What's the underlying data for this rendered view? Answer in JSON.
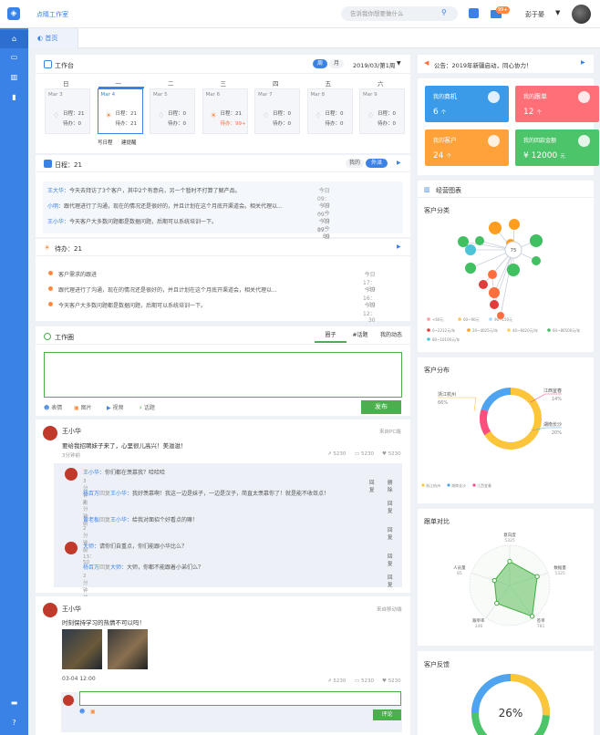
{
  "app": {
    "name": "点睛工作室"
  },
  "header": {
    "search_placeholder": "告诉我你想要做什么",
    "mail_badge": "99+",
    "username": "彭于晏"
  },
  "tabs": [
    {
      "label": "首页"
    }
  ],
  "workbench": {
    "title": "工作台",
    "toggle": [
      "周",
      "月"
    ],
    "active_toggle": "周",
    "period": "2019/03/第1周",
    "weekdays": [
      "日",
      "一",
      "二",
      "三",
      "四",
      "五",
      "六"
    ],
    "days": [
      {
        "date": "Mar 3",
        "schedule": "日程：21",
        "todo": "待办：0",
        "todo_alert": false,
        "lit": false
      },
      {
        "date": "Mar 4",
        "schedule": "日程：21",
        "todo": "待办：21",
        "todo_alert": false,
        "lit": true,
        "selected": true
      },
      {
        "date": "Mar 5",
        "schedule": "日程：0",
        "todo": "待办：0",
        "todo_alert": false,
        "lit": false
      },
      {
        "date": "Mar 6",
        "schedule": "日程：21",
        "todo": "待办：99+",
        "todo_alert": true,
        "lit": true
      },
      {
        "date": "Mar 7",
        "schedule": "日程：0",
        "todo": "待办：0",
        "todo_alert": false,
        "lit": false
      },
      {
        "date": "Mar 8",
        "schedule": "日程：0",
        "todo": "待办：0",
        "todo_alert": false,
        "lit": false
      },
      {
        "date": "Mar 9",
        "schedule": "日程：0",
        "todo": "待办：0",
        "todo_alert": false,
        "lit": false
      }
    ],
    "day_actions": [
      "写日程",
      "建提醒"
    ]
  },
  "schedule": {
    "title": "日程：21",
    "toggle": [
      "我的",
      "外派"
    ],
    "items": [
      {
        "name": "王大华：",
        "text": "今天去拜访了3个客户，其中2个有意向，另一个暂时不打算了解产品。",
        "time": "今日 09：00 ~ 今日 17：30"
      },
      {
        "name": "小明：",
        "text": "跟代理进行了沟通，现在的情况还是很好的，并且计划在这个月底开渠道会。相关代理以...",
        "time": "今日 09：00 ~ 今日 17：30"
      },
      {
        "name": "王小华：",
        "text": "今天客户大多数问题都是数据问题，后期可以系统培训一下。",
        "time": "今日 09：00 ~ 今日 17：30"
      }
    ]
  },
  "todo": {
    "title": "待办：21",
    "items": [
      {
        "text": "客户需求的跟进",
        "time": "今日 17：30"
      },
      {
        "text": "跟代理进行了沟通，现在的情况还是很好的，并且计划在这个月底开渠道会，相关代理以...",
        "time": "今日 16：30"
      },
      {
        "text": "今天客户大多数问题都是数据问题，后期可以系统培训一下。",
        "time": "今日 12：30"
      }
    ]
  },
  "circle": {
    "title": "工作圈",
    "tabs": [
      "圈子",
      "#话题",
      "我的动态"
    ],
    "tools": [
      "表情",
      "图片",
      "视频",
      "话题"
    ],
    "publish": "发布"
  },
  "posts": [
    {
      "author": "王小华",
      "source": "来自PC端",
      "content": "要给我招聘妹子来了，心里很儿高兴！美滋滋！",
      "time": "3分钟前",
      "stats": [
        "5230",
        "5230",
        "5230"
      ],
      "replies": [
        {
          "from": "王小华：",
          "text": "你们都在羡慕我？哈哈哈",
          "time": "3分钟前",
          "actions": [
            "回复",
            "删除"
          ]
        },
        {
          "from": "杨百万",
          "mid": "回复",
          "to": "王小华：",
          "text": "我好羡慕啊！我这一边是妹子，一边是汉子，简直太羡慕你了！就是能不收敛点！",
          "time": "2分钟前",
          "action": "回复"
        },
        {
          "from": "黄老板",
          "mid": "回复",
          "to": "王小华：",
          "text": "给我对面招个好看点的嘛！",
          "time": "2分钟前",
          "action": "回复"
        },
        {
          "from": "大师：",
          "text": "请你们自重点，你们能跟小华比么？",
          "time": "13：50",
          "action": "回复"
        },
        {
          "from": "杨百万",
          "mid": "回复",
          "to": "大师：",
          "text": "大师，你都不能跟着小弟们么？",
          "time": "2分钟前",
          "action": "回复"
        }
      ]
    },
    {
      "author": "王小华",
      "source": "来自移动端",
      "content": "时刻保持学习的热情不可以吗！",
      "time": "03-04 12:00",
      "stats": [
        "5230",
        "5230",
        "5230"
      ],
      "comment_button": "评论"
    }
  ],
  "notice": {
    "text": "公告：2019年新疆启动，同心协力！"
  },
  "stats": [
    {
      "label": "我的",
      "label2": "商机",
      "value": "6",
      "unit": "个",
      "color": "#3b9be8"
    },
    {
      "label": "我的",
      "label2": "跟单",
      "value": "12",
      "unit": "个",
      "color": "#ff6f77"
    },
    {
      "label": "我的",
      "label2": "客户",
      "value": "24",
      "unit": "个",
      "color": "#ffa23a"
    },
    {
      "label": "我的回款金额",
      "label2": "",
      "value": "¥ 12000",
      "unit": "元",
      "color": "#4cc46a"
    }
  ],
  "charts_title": "经营图表",
  "chart_data": [
    {
      "type": "network",
      "title": "客户分类",
      "center_value": "75",
      "legend": [
        "<60元",
        "60~90元",
        "90~150元",
        "0~2212元/年",
        "20~4025元/年",
        "40~6020元/年",
        "60~80500元/年",
        "80~10100元/年"
      ]
    },
    {
      "type": "pie",
      "title": "客户分布",
      "slices": [
        {
          "name": "浙江杭州",
          "value": 66,
          "label": "66%",
          "color": "#fcc53a"
        },
        {
          "name": "江西宜春",
          "value": 14,
          "label": "14%",
          "color": "#ff4d7e"
        },
        {
          "name": "湖南长沙",
          "value": 20,
          "label": "20%",
          "color": "#4ea4f0"
        }
      ],
      "legend": [
        "浙江杭州",
        "湖南长沙",
        "江西宜春"
      ]
    },
    {
      "type": "radar",
      "title": "跟单对比",
      "axes": [
        {
          "name": "意向度",
          "value": "5325"
        },
        {
          "name": "数据量",
          "value": "5325"
        },
        {
          "name": "签单",
          "value": "781"
        },
        {
          "name": "跟单率",
          "value": "346"
        },
        {
          "name": "人员量",
          "value": "85"
        }
      ]
    },
    {
      "type": "donut",
      "title": "客户反馈",
      "value": "26%"
    }
  ]
}
